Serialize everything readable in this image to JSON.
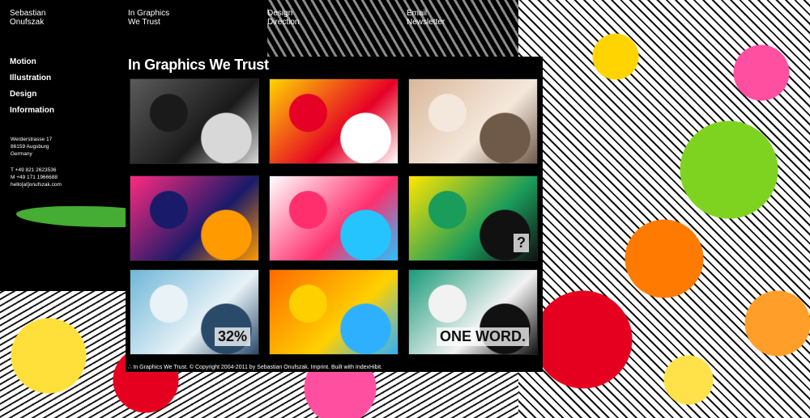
{
  "nav": {
    "author": "Sebastian\nOnufszak",
    "item2": "In Graphics\nWe Trust",
    "item3": "Design\nDirection",
    "item4": "Email\nNewsletter"
  },
  "sidebar": {
    "items": [
      "Motion",
      "Illustration",
      "Design",
      "Information"
    ]
  },
  "address": "Werderstrasse 17\n86159 Augsburg\nGermany",
  "contact": "T +49 821 2623536\nM +49 171 1966688\nhello[at]onufszak.com",
  "main": {
    "title": "In Graphics We Trust",
    "thumbs": [
      {
        "colors": [
          "#5a5a5a",
          "#1a1a1a",
          "#d8d8d8"
        ],
        "label": ""
      },
      {
        "colors": [
          "#ffd400",
          "#e60026",
          "#ffffff"
        ],
        "label": ""
      },
      {
        "colors": [
          "#d9b89a",
          "#f4e8dc",
          "#6f5a4a"
        ],
        "label": ""
      },
      {
        "colors": [
          "#ff2a80",
          "#1a1a6a",
          "#ff9a00"
        ],
        "label": ""
      },
      {
        "colors": [
          "#ffffff",
          "#ff2f6e",
          "#25c4ff"
        ],
        "label": ""
      },
      {
        "colors": [
          "#ffe600",
          "#1a9c5a",
          "#111111"
        ],
        "label": "?"
      },
      {
        "colors": [
          "#6fb7d8",
          "#e8f2f7",
          "#2a4a6a"
        ],
        "label": "32%"
      },
      {
        "colors": [
          "#ff6a00",
          "#ffd000",
          "#2fb0ff"
        ],
        "label": ""
      },
      {
        "colors": [
          "#1a9c7a",
          "#f2f2f2",
          "#111111"
        ],
        "label": "ONE WORD."
      }
    ]
  },
  "footer": "∴ In Graphics We Trust. © Copyright 2004-2011 by Sebastian Onufszak. Imprint. Built with IndexHibit."
}
